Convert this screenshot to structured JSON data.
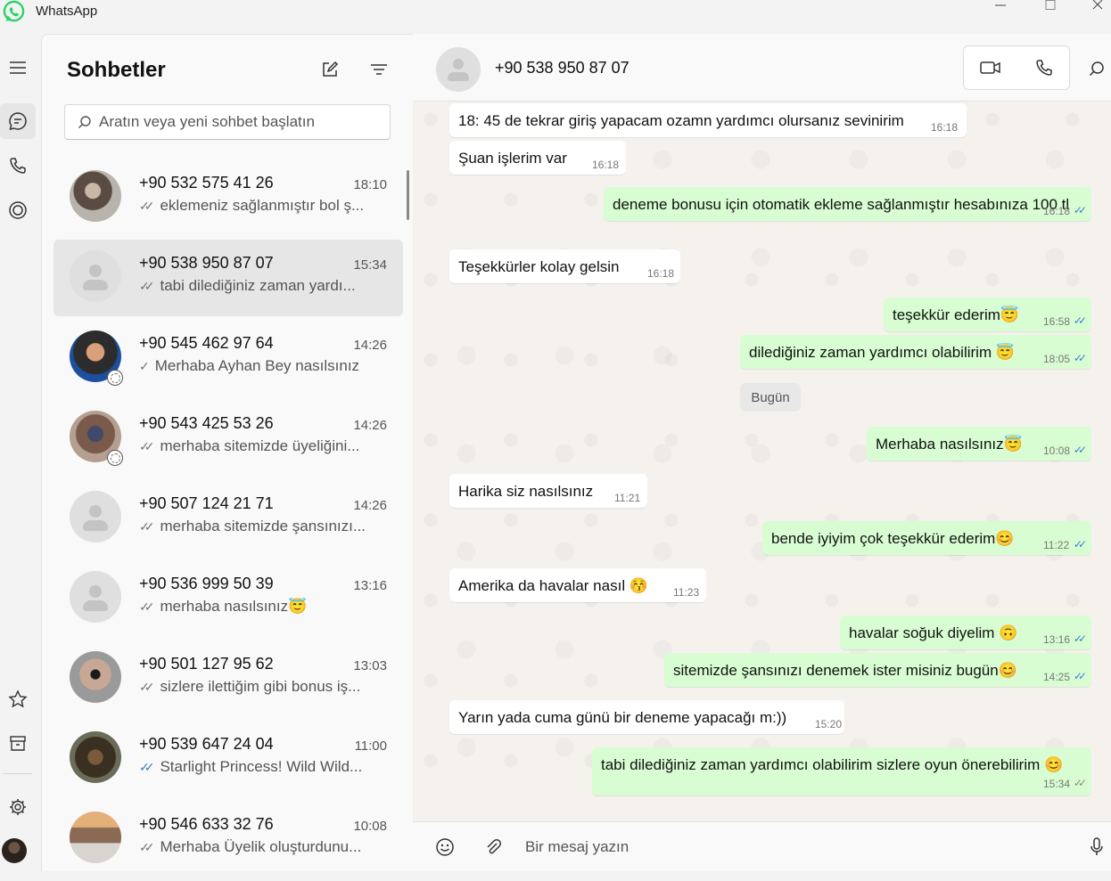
{
  "app": {
    "title": "WhatsApp",
    "brand_color": "#25D366"
  },
  "list": {
    "title": "Sohbetler",
    "search_placeholder": "Aratın veya yeni sohbet başlatın",
    "chats": [
      {
        "name": "+90 532 575 41 26",
        "time": "18:10",
        "tick": "✓✓",
        "preview": "eklemeniz sağlanmıştır bol ş...",
        "avatar": "photo",
        "read": false
      },
      {
        "name": "+90 538 950 87 07",
        "time": "15:34",
        "tick": "✓✓",
        "preview": "tabi dilediğiniz zaman yardı...",
        "avatar": "placeholder",
        "read": false
      },
      {
        "name": "+90 545 462 97 64",
        "time": "14:26",
        "tick": "✓",
        "preview": "Merhaba Ayhan Bey nasılsınız",
        "avatar": "photo",
        "read": false
      },
      {
        "name": "+90 543 425 53 26",
        "time": "14:26",
        "tick": "✓✓",
        "preview": "merhaba sitemizde üyeliğini...",
        "avatar": "photo",
        "read": false
      },
      {
        "name": "+90 507 124 21 71",
        "time": "14:26",
        "tick": "✓✓",
        "preview": "merhaba sitemizde şansınızı...",
        "avatar": "placeholder",
        "read": false
      },
      {
        "name": "+90 536 999 50 39",
        "time": "13:16",
        "tick": "✓✓",
        "preview": "merhaba nasılsınız😇",
        "avatar": "placeholder",
        "read": false
      },
      {
        "name": "+90 501 127 95 62",
        "time": "13:03",
        "tick": "✓✓",
        "preview": "sizlere ilettiğim gibi bonus iş...",
        "avatar": "photo",
        "read": false
      },
      {
        "name": "+90 539 647 24 04",
        "time": "11:00",
        "tick": "✓✓",
        "preview": "Starlight Princess! Wild Wild...",
        "avatar": "photo",
        "read": true
      },
      {
        "name": "+90 546 633 32 76",
        "time": "10:08",
        "tick": "✓✓",
        "preview": "Merhaba Üyelik oluşturdunu...",
        "avatar": "photo",
        "read": false
      }
    ]
  },
  "conversation": {
    "name": "+90 538 950 87 07",
    "day_label": "Bugün",
    "composer_placeholder": "Bir mesaj yazın",
    "messages": [
      {
        "dir": "in",
        "text": "18: 45 de tekrar giriş yapacam ozamn yardımcı olursanız sevinirim",
        "time": "16:18"
      },
      {
        "dir": "in",
        "text": "Şuan işlerim var",
        "time": "16:18"
      },
      {
        "dir": "out",
        "text": "deneme bonusu için otomatik ekleme sağlanmıştır hesabınıza 100 tl",
        "time": "16:18",
        "tick": "✓✓"
      },
      {
        "dir": "in",
        "text": "Teşekkürler kolay gelsin",
        "time": "16:18"
      },
      {
        "dir": "out",
        "text": "teşekkür ederim😇",
        "time": "16:58",
        "tick": "✓✓"
      },
      {
        "dir": "out",
        "text": "dilediğiniz zaman yardımcı olabilirim 😇",
        "time": "18:05",
        "tick": "✓✓"
      },
      {
        "dir": "out",
        "text": "Merhaba nasılsınız😇",
        "time": "10:08",
        "tick": "✓✓"
      },
      {
        "dir": "in",
        "text": "Harika siz nasılsınız",
        "time": "11:21"
      },
      {
        "dir": "out",
        "text": "bende iyiyim çok teşekkür ederim😊",
        "time": "11:22",
        "tick": "✓✓"
      },
      {
        "dir": "in",
        "text": "Amerika da havalar nasıl 😚",
        "time": "11:23"
      },
      {
        "dir": "out",
        "text": "havalar soğuk diyelim 🙃",
        "time": "13:16",
        "tick": "✓✓"
      },
      {
        "dir": "out",
        "text": "sitemizde şansınızı denemek ister misiniz bugün😊",
        "time": "14:25",
        "tick": "✓✓"
      },
      {
        "dir": "in",
        "text": "Yarın yada cuma günü bir deneme yapacağı m:))",
        "time": "15:20"
      },
      {
        "dir": "out",
        "text": "tabi dilediğiniz zaman yardımcı olabilirim sizlere oyun önerebilirim 😊",
        "time": "15:34",
        "tick": "✓✓"
      }
    ]
  },
  "colors": {
    "outgoing_bubble": "#d8fdd2",
    "incoming_bubble": "#ffffff",
    "read_tick": "#3b7fd6",
    "selected_row": "#e6e6e6"
  }
}
